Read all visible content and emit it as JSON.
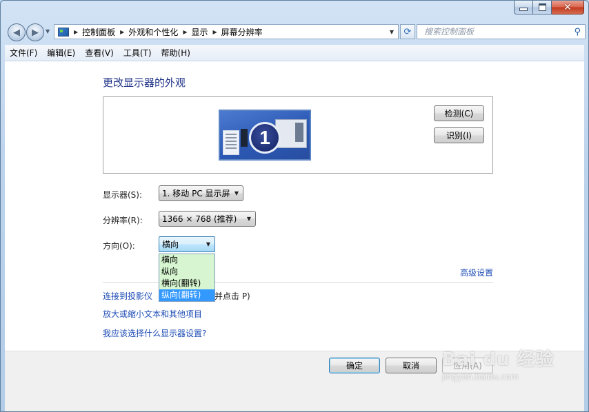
{
  "window": {
    "minimize_glyph": "–",
    "maximize_glyph": "□",
    "close_glyph": "✕"
  },
  "nav": {
    "back_icon": "back-arrow-icon",
    "forward_icon": "forward-arrow-icon",
    "breadcrumbs": [
      "控制面板",
      "外观和个性化",
      "显示",
      "屏幕分辨率"
    ],
    "search_placeholder": "搜索控制面板"
  },
  "menu": {
    "items": [
      "文件(F)",
      "编辑(E)",
      "查看(V)",
      "工具(T)",
      "帮助(H)"
    ]
  },
  "main": {
    "title": "更改显示器的外观",
    "monitor_number": "1",
    "detect_button": "检测(C)",
    "identify_button": "识别(I)",
    "display_label": "显示器(S):",
    "display_value": "1. 移动 PC 显示屏",
    "resolution_label": "分辨率(R):",
    "resolution_value": "1366 × 768 (推荐)",
    "orientation_label": "方向(O):",
    "orientation_value": "横向",
    "orientation_options": [
      "横向",
      "纵向",
      "横向(翻转)",
      "纵向(翻转)"
    ],
    "orientation_highlighted_index": 3,
    "advanced_link": "高级设置",
    "projector_link": "连接到投影仪",
    "projector_hint_visible_prefix": "(",
    "projector_hint_tail": "并点击 P)",
    "text_size_link": "放大或缩小文本和其他项目",
    "which_settings_link": "我应该选择什么显示器设置?"
  },
  "footer": {
    "ok_button": "确定",
    "cancel_button": "取消",
    "apply_button": "应用(A)"
  },
  "watermark": {
    "logo": "Bai du 经验",
    "url": "jingyan.baidu.com"
  }
}
